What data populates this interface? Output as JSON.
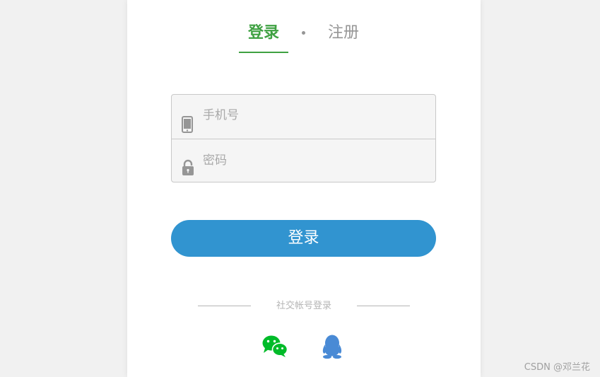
{
  "tabs": {
    "login": "登录",
    "register": "注册"
  },
  "form": {
    "phone_placeholder": "手机号",
    "password_placeholder": "密码",
    "submit_label": "登录"
  },
  "social": {
    "label": "社交帐号登录",
    "icons": [
      "wechat-icon",
      "qq-icon"
    ]
  },
  "watermark": "CSDN @邓兰花",
  "colors": {
    "accent_green": "#3fa142",
    "button_blue": "#3194d0",
    "wechat_green": "#00bb29",
    "qq_blue": "#498ad5"
  }
}
